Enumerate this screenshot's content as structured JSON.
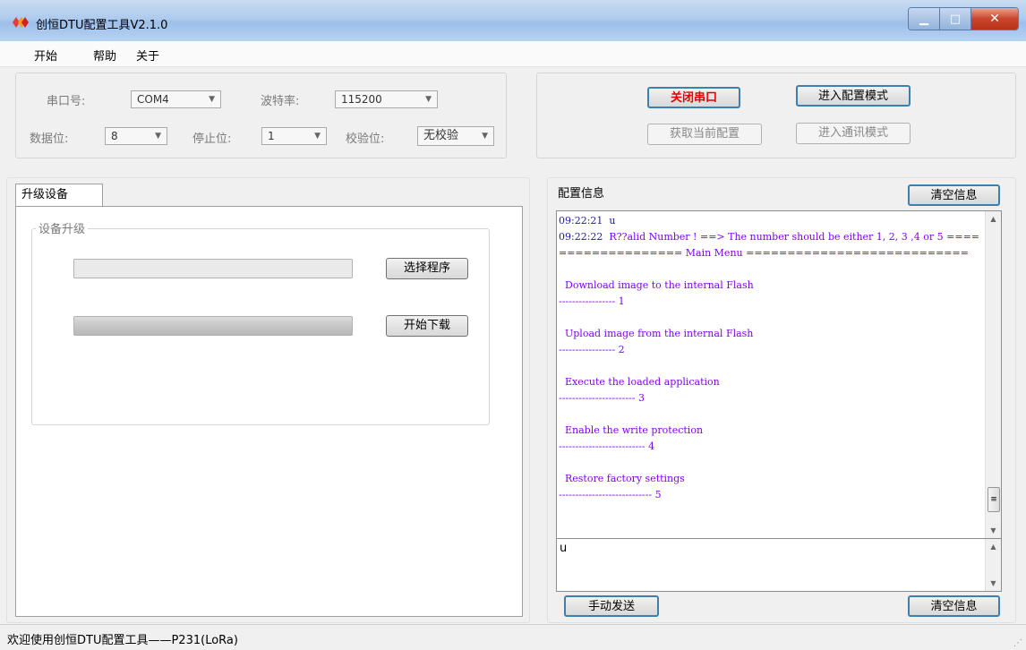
{
  "window": {
    "title": "创恒DTU配置工具V2.1.0",
    "minimize_glyph": "▁",
    "maximize_glyph": "□",
    "close_glyph": "✕"
  },
  "menu": [
    "开始",
    "帮助",
    "关于"
  ],
  "serial": {
    "port_label": "串口号:",
    "port_value": "COM4",
    "baud_label": "波特率:",
    "baud_value": "115200",
    "databits_label": "数据位:",
    "databits_value": "8",
    "stopbits_label": "停止位:",
    "stopbits_value": "1",
    "parity_label": "校验位:",
    "parity_value": "无校验"
  },
  "actions": {
    "close_port": "关闭串口",
    "enter_config": "进入配置模式",
    "get_config": "获取当前配置",
    "enter_comm": "进入通讯模式"
  },
  "upgrade": {
    "tab_label": "升级设备",
    "group_label": "设备升级",
    "select_program": "选择程序",
    "start_download": "开始下载",
    "progress": 1.0
  },
  "config_info": {
    "label": "配置信息",
    "clear_top": "清空信息",
    "log": [
      {
        "ts": "09:22:21",
        "text": "u"
      },
      {
        "ts": "09:22:22",
        "text": "R??alid Number ! ==> The number should be either 1, 2, 3 ,4 or 5 =================== Main Menu ==========================="
      },
      {
        "ts": "",
        "text": ""
      },
      {
        "ts": "",
        "text": "  Download image to the internal Flash"
      },
      {
        "ts": "",
        "text": "----------------- 1"
      },
      {
        "ts": "",
        "text": ""
      },
      {
        "ts": "",
        "text": "  Upload image from the internal Flash"
      },
      {
        "ts": "",
        "text": "----------------- 2"
      },
      {
        "ts": "",
        "text": ""
      },
      {
        "ts": "",
        "text": "  Execute the loaded application"
      },
      {
        "ts": "",
        "text": "----------------------- 3"
      },
      {
        "ts": "",
        "text": ""
      },
      {
        "ts": "",
        "text": "  Enable the write protection"
      },
      {
        "ts": "",
        "text": "-------------------------- 4"
      },
      {
        "ts": "",
        "text": ""
      },
      {
        "ts": "",
        "text": "  Restore factory settings"
      },
      {
        "ts": "",
        "text": "---------------------------- 5"
      }
    ],
    "send_value": "u",
    "send_button": "手动发送",
    "clear_bottom": "清空信息"
  },
  "status": {
    "text": "欢迎使用创恒DTU配置工具——P231(LoRa)"
  },
  "icons": {
    "app": "diamond-logo-icon",
    "dropdown": "chevron-down-icon",
    "scroll_up": "scroll-up-icon",
    "scroll_down": "scroll-down-icon",
    "thumb_grip": "grip-icon",
    "resize": "resize-grip-icon"
  },
  "colors": {
    "log_text": "#8000ff",
    "close_port_text": "#e00000",
    "title_gradient": "#aecbee"
  }
}
